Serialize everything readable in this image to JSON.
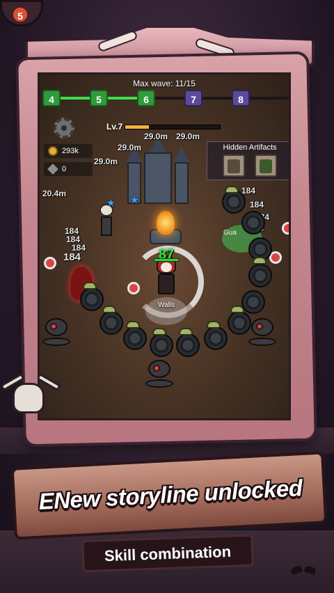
{
  "lamp_number": "5",
  "hud": {
    "max_wave_label": "Max wave: 11/15",
    "wave_nodes": [
      {
        "label": "4",
        "state": "done"
      },
      {
        "label": "5",
        "state": "done"
      },
      {
        "label": "6",
        "state": "done"
      },
      {
        "label": "7",
        "state": "todo"
      },
      {
        "label": "8",
        "state": "todo"
      }
    ],
    "level_label": "Lv.7",
    "xp_fraction": 0.25,
    "coins": "293k",
    "gems": "0",
    "hidden_artifacts_title": "Hidden Artifacts"
  },
  "combat": {
    "damage_numbers": [
      "29.0m",
      "29.0m",
      "29.0m",
      "29.0m",
      "20.4m",
      "184",
      "184",
      "184",
      "184",
      "184",
      "184",
      "184",
      "184"
    ],
    "hero_hp": "87",
    "walls_label": "Walls",
    "guard_label": "Gua"
  },
  "banner": {
    "title": "ENew storyline unlocked",
    "subtitle": "Skill combination"
  },
  "colors": {
    "frame": "#c4868f",
    "wave_done": "#2e9c3a",
    "wave_todo": "#5b4a9a",
    "hp_text": "#39e64a",
    "progress_fill": "#3ce04a"
  },
  "icons": [
    "lamp-icon",
    "gear-icon",
    "coin-icon",
    "gem-icon",
    "artifact-icon",
    "star-icon",
    "skull-icon",
    "bone-icon",
    "bat-icon"
  ]
}
